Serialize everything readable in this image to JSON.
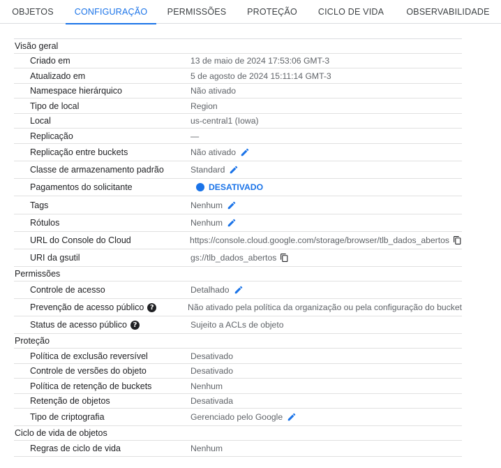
{
  "tabs": [
    {
      "label": "OBJETOS",
      "active": false
    },
    {
      "label": "CONFIGURAÇÃO",
      "active": true
    },
    {
      "label": "PERMISSÕES",
      "active": false
    },
    {
      "label": "PROTEÇÃO",
      "active": false
    },
    {
      "label": "CICLO DE VIDA",
      "active": false
    },
    {
      "label": "OBSERVABILIDADE",
      "active": false
    }
  ],
  "sections": {
    "overview": {
      "title": "Visão geral",
      "rows": {
        "created": {
          "label": "Criado em",
          "value": "13 de maio de 2024 17:53:06 GMT-3"
        },
        "updated": {
          "label": "Atualizado em",
          "value": "5 de agosto de 2024 15:11:14 GMT-3"
        },
        "namespace": {
          "label": "Namespace hierárquico",
          "value": "Não ativado"
        },
        "location_type": {
          "label": "Tipo de local",
          "value": "Region"
        },
        "location": {
          "label": "Local",
          "value": "us-central1 (Iowa)"
        },
        "replication": {
          "label": "Replicação",
          "value": "—"
        },
        "cross_replication": {
          "label": "Replicação entre buckets",
          "value": "Não ativado"
        },
        "storage_class": {
          "label": "Classe de armazenamento padrão",
          "value": "Standard"
        },
        "requester_pays": {
          "label": "Pagamentos do solicitante",
          "value": "DESATIVADO"
        },
        "tags": {
          "label": "Tags",
          "value": "Nenhum"
        },
        "labels": {
          "label": "Rótulos",
          "value": "Nenhum"
        },
        "console_url": {
          "label": "URL do Console do Cloud",
          "value": "https://console.cloud.google.com/storage/browser/tlb_dados_abertos"
        },
        "gsutil_uri": {
          "label": "URI da gsutil",
          "value": "gs://tlb_dados_abertos"
        }
      }
    },
    "permissions": {
      "title": "Permissões",
      "rows": {
        "access_control": {
          "label": "Controle de acesso",
          "value": "Detalhado"
        },
        "public_prevention": {
          "label": "Prevenção de acesso público",
          "value": "Não ativado pela política da organização ou pela configuração do bucket"
        },
        "public_status": {
          "label": "Status de acesso público",
          "value": "Sujeito a ACLs de objeto"
        }
      }
    },
    "protection": {
      "title": "Proteção",
      "rows": {
        "soft_delete": {
          "label": "Política de exclusão reversível",
          "value": "Desativado"
        },
        "versioning": {
          "label": "Controle de versões do objeto",
          "value": "Desativado"
        },
        "bucket_retention": {
          "label": "Política de retenção de buckets",
          "value": "Nenhum"
        },
        "object_retention": {
          "label": "Retenção de objetos",
          "value": "Desativada"
        },
        "encryption": {
          "label": "Tipo de criptografia",
          "value": "Gerenciado pelo Google"
        }
      }
    },
    "lifecycle": {
      "title": "Ciclo de vida de objetos",
      "rows": {
        "rules": {
          "label": "Regras de ciclo de vida",
          "value": "Nenhum"
        }
      }
    }
  },
  "colors": {
    "accent": "#1a73e8",
    "text": "#202124",
    "muted": "#5f6368",
    "divider": "#e0e0e0"
  },
  "icons": {
    "edit": "pencil-icon",
    "copy": "copy-icon",
    "help": "help-icon",
    "status": "status-dot-icon"
  }
}
